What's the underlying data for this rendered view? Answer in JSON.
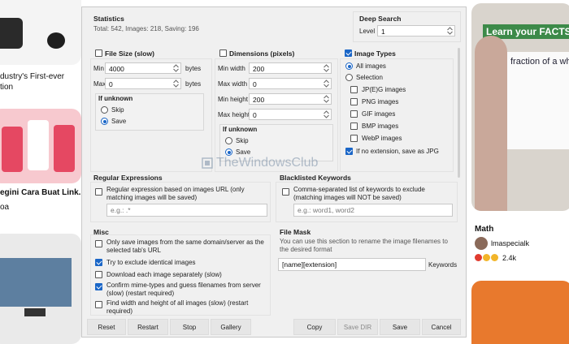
{
  "background": {
    "left_caption_1": "dustry's First-ever",
    "left_caption_2": "tion",
    "left_caption_3": "egini Cara Buat Link...",
    "left_caption_4": "oa",
    "right_banner": "Learn your FACTS",
    "right_board_text": "fraction of a whole",
    "right_title": "Math",
    "right_user": "lmaspecialk",
    "right_reactions": "2.4k"
  },
  "watermark": "TheWindowsClub",
  "statistics": {
    "title": "Statistics",
    "summary": "Total: 542, Images: 218, Saving: 196"
  },
  "deep_search": {
    "title": "Deep Search",
    "level_label": "Level",
    "level_value": "1"
  },
  "file_size": {
    "title": "File Size (slow)",
    "min_label": "Min",
    "min_value": "4000",
    "min_unit": "bytes",
    "max_label": "Max",
    "max_value": "0",
    "max_unit": "bytes",
    "if_unknown": "If unknown",
    "skip": "Skip",
    "save": "Save"
  },
  "dimensions": {
    "title": "Dimensions (pixels)",
    "min_width_label": "Min width",
    "min_width": "200",
    "max_width_label": "Max width",
    "max_width": "0",
    "min_height_label": "Min height",
    "min_height": "200",
    "max_height_label": "Max height",
    "max_height": "0",
    "if_unknown": "If unknown",
    "skip": "Skip",
    "save": "Save"
  },
  "image_types": {
    "title": "Image Types",
    "all_images": "All images",
    "selection": "Selection",
    "jpeg": "JP(E)G images",
    "png": "PNG images",
    "gif": "GIF images",
    "bmp": "BMP images",
    "webp": "WebP images",
    "no_ext": "If no extension, save as JPG"
  },
  "regex": {
    "title": "Regular Expressions",
    "label": "Regular expression based on images URL (only matching images will be saved)",
    "placeholder": "e.g.: .*"
  },
  "blacklist": {
    "title": "Blacklisted Keywords",
    "label": "Comma-separated list of keywords to exclude (matching images will NOT be saved)",
    "placeholder": "e.g.: word1, word2"
  },
  "misc": {
    "title": "Misc",
    "opt1": "Only save images from the same domain/server as the selected tab's URL",
    "opt2": "Try to exclude identical images",
    "opt3": "Download each image separately (slow)",
    "opt4": "Confirm mime-types and guess filenames from server (slow) (restart required)",
    "opt5": "Find width and height of all images (slow) (restart required)"
  },
  "file_mask": {
    "title": "File Mask",
    "description": "You can use this section to rename the image filenames to the desired format",
    "value": "[name][extension]",
    "keywords": "Keywords"
  },
  "buttons": {
    "reset": "Reset",
    "restart": "Restart",
    "stop": "Stop",
    "gallery": "Gallery",
    "copy": "Copy",
    "save_dir": "Save DIR",
    "save": "Save",
    "cancel": "Cancel"
  },
  "colors": {
    "accent": "#1a66c7",
    "dialog_bg": "#f0f0f0"
  }
}
